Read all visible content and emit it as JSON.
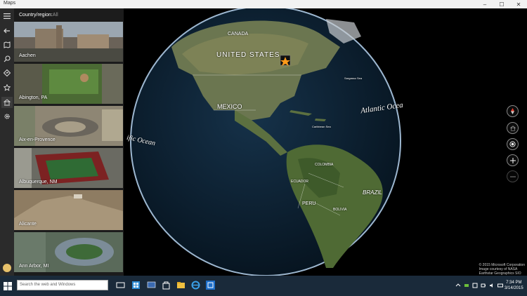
{
  "window": {
    "title": "Maps",
    "minimize": "–",
    "maximize": "☐",
    "close": "✕"
  },
  "panel": {
    "filter_label": "Country/region:",
    "filter_value": "All",
    "places": [
      {
        "name": "Aachen",
        "color": "#5a5248"
      },
      {
        "name": "Abington, PA",
        "color": "#4f6d3c"
      },
      {
        "name": "Aix-en-Provence",
        "color": "#8a8070"
      },
      {
        "name": "Albuquerque, NM",
        "color": "#7a2a2a"
      },
      {
        "name": "Alicante",
        "color": "#8c7b62"
      },
      {
        "name": "Ann Arbor, MI",
        "color": "#5a6a7a"
      }
    ]
  },
  "map": {
    "labels": {
      "united_states": "UNITED STATES",
      "canada": "CANADA",
      "mexico": "MEXICO",
      "atlantic": "Atlantic Ocea",
      "pacific": "ific Ocean",
      "brazil": "BRAZIL",
      "peru": "PERU",
      "colombia": "COLOMBIA",
      "ecuador": "ECUADOR",
      "bolivia": "BOLIVIA",
      "sargasso": "Sargasso Sea",
      "caribbean": "Caribbean Sea"
    },
    "copyright_lines": [
      "© 2015 Microsoft Corporation",
      "Image courtesy of NASA",
      "Earthstar Geographics SIO"
    ]
  },
  "taskbar": {
    "search_placeholder": "Search the web and Windows",
    "time": "7:34 PM",
    "date": "3/14/2015"
  },
  "colors": {
    "titlebar": "#f2f2f2",
    "rail": "#2b2b2b",
    "panel": "#1c1c1c",
    "taskbar": "#1a2a3a",
    "ocean": "#0d2233",
    "land": "#5a6b3a"
  }
}
